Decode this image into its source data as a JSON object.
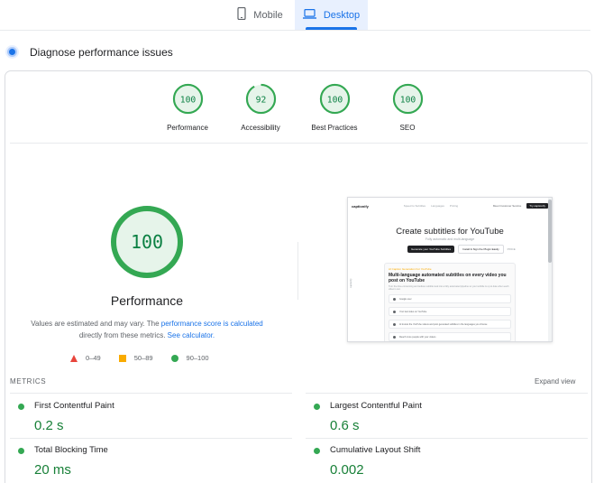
{
  "tabs": [
    {
      "label": "Mobile",
      "icon": "phone-icon",
      "active": false
    },
    {
      "label": "Desktop",
      "icon": "laptop-icon",
      "active": true
    }
  ],
  "section_title": "Diagnose performance issues",
  "scores": [
    {
      "label": "Performance",
      "value": "100"
    },
    {
      "label": "Accessibility",
      "value": "92"
    },
    {
      "label": "Best Practices",
      "value": "100"
    },
    {
      "label": "SEO",
      "value": "100"
    }
  ],
  "main_score": {
    "label": "Performance",
    "value": "100"
  },
  "description": {
    "text1": "Values are estimated and may vary. The ",
    "link1": "performance score is calculated",
    "text2": " directly from these metrics. ",
    "link2": "See calculator."
  },
  "legend": [
    {
      "label": "0–49",
      "color": "#e8453c"
    },
    {
      "label": "50–89",
      "color": "#f9ab00"
    },
    {
      "label": "90–100",
      "color": "#34a853"
    }
  ],
  "thumbnail": {
    "logo": "captionify",
    "nav_links": [
      "Speed to Subtitles",
      "Languages",
      "Pricing"
    ],
    "nav_right": "Meet Customer Service",
    "nav_button": "Try captionify",
    "title": "Create subtitles for YouTube",
    "subtitle": "Fully automatic and multi-language",
    "button1": "Generate your YouTube Subtitles",
    "button2": "Install & Sign the Plugin Easily",
    "button3": "PRICE",
    "panel_tag": "AI Caption Generation For YouTube",
    "panel_heading": "Multi-language automated subtitles on every video you post on YouTube",
    "panel_text": "Turn the time-consuming and tedious subtitle task into a fully automated pipeline so your subtitle is up to date when each video is out.",
    "rows": [
      "Google user",
      "Your last video on YouTube",
      "AI knows the YouTube videos and post generated subtitles in the languages you choose",
      "Reach more people with your videos"
    ]
  },
  "metrics_heading": "METRICS",
  "expand_label": "Expand view",
  "metrics": [
    {
      "title": "First Contentful Paint",
      "value": "0.2 s",
      "status": "good"
    },
    {
      "title": "Largest Contentful Paint",
      "value": "0.6 s",
      "status": "good"
    },
    {
      "title": "Total Blocking Time",
      "value": "20 ms",
      "status": "good"
    },
    {
      "title": "Cumulative Layout Shift",
      "value": "0.002",
      "status": "good"
    }
  ],
  "colors": {
    "good": "#34a853",
    "good_text": "#0b8043",
    "accent": "#1a73e8"
  }
}
